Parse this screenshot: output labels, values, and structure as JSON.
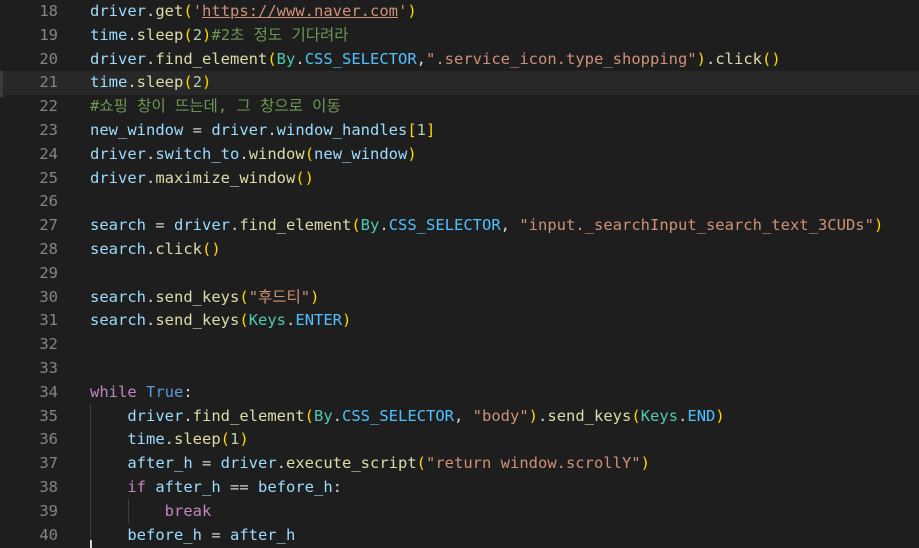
{
  "colors": {
    "background": "#1e1e1e",
    "line_number": "#858585",
    "variable": "#9cdcfe",
    "function": "#dcdcaa",
    "class": "#4ec9b0",
    "constant": "#4fc1ff",
    "string": "#ce9178",
    "number": "#b5cea8",
    "comment": "#6a9955",
    "keyword_control": "#c586c0",
    "keyword_builtin": "#569cd6",
    "bracket_level_1": "#ffd700",
    "bracket_level_2": "#da70d6",
    "bracket_level_3": "#179fff"
  },
  "editor": {
    "current_line": 21,
    "lines": [
      {
        "num": "18",
        "tokens": [
          [
            "var",
            "driver"
          ],
          [
            "op",
            "."
          ],
          [
            "fn",
            "get"
          ],
          [
            "b1",
            "("
          ],
          [
            "str",
            "'"
          ],
          [
            "str link",
            "https://www.naver.com"
          ],
          [
            "str",
            "'"
          ],
          [
            "b1",
            ")"
          ]
        ]
      },
      {
        "num": "19",
        "tokens": [
          [
            "var",
            "time"
          ],
          [
            "op",
            "."
          ],
          [
            "fn",
            "sleep"
          ],
          [
            "b1",
            "("
          ],
          [
            "num",
            "2"
          ],
          [
            "b1",
            ")"
          ],
          [
            "cmt",
            "#2초 정도 기다려라"
          ]
        ]
      },
      {
        "num": "20",
        "tokens": [
          [
            "var",
            "driver"
          ],
          [
            "op",
            "."
          ],
          [
            "fn",
            "find_element"
          ],
          [
            "b1",
            "("
          ],
          [
            "cls",
            "By"
          ],
          [
            "op",
            "."
          ],
          [
            "con",
            "CSS_SELECTOR"
          ],
          [
            "op",
            ","
          ],
          [
            "str",
            "\".service_icon.type_shopping\""
          ],
          [
            "b1",
            ")"
          ],
          [
            "op",
            "."
          ],
          [
            "fn",
            "click"
          ],
          [
            "b1",
            "()"
          ]
        ]
      },
      {
        "num": "21",
        "tokens": [
          [
            "var",
            "time"
          ],
          [
            "op",
            "."
          ],
          [
            "fn",
            "sleep"
          ],
          [
            "b1",
            "("
          ],
          [
            "num",
            "2"
          ],
          [
            "b1",
            ")"
          ]
        ]
      },
      {
        "num": "22",
        "tokens": [
          [
            "cmt",
            "#쇼핑 창이 뜨는데, 그 창으로 이동"
          ]
        ]
      },
      {
        "num": "23",
        "tokens": [
          [
            "var",
            "new_window"
          ],
          [
            "op",
            " = "
          ],
          [
            "var",
            "driver"
          ],
          [
            "op",
            "."
          ],
          [
            "var",
            "window_handles"
          ],
          [
            "b1",
            "["
          ],
          [
            "num",
            "1"
          ],
          [
            "b1",
            "]"
          ]
        ]
      },
      {
        "num": "24",
        "tokens": [
          [
            "var",
            "driver"
          ],
          [
            "op",
            "."
          ],
          [
            "var",
            "switch_to"
          ],
          [
            "op",
            "."
          ],
          [
            "fn",
            "window"
          ],
          [
            "b1",
            "("
          ],
          [
            "var",
            "new_window"
          ],
          [
            "b1",
            ")"
          ]
        ]
      },
      {
        "num": "25",
        "tokens": [
          [
            "var",
            "driver"
          ],
          [
            "op",
            "."
          ],
          [
            "fn",
            "maximize_window"
          ],
          [
            "b1",
            "()"
          ]
        ]
      },
      {
        "num": "26",
        "tokens": []
      },
      {
        "num": "27",
        "tokens": [
          [
            "var",
            "search"
          ],
          [
            "op",
            " = "
          ],
          [
            "var",
            "driver"
          ],
          [
            "op",
            "."
          ],
          [
            "fn",
            "find_element"
          ],
          [
            "b1",
            "("
          ],
          [
            "cls",
            "By"
          ],
          [
            "op",
            "."
          ],
          [
            "con",
            "CSS_SELECTOR"
          ],
          [
            "op",
            ", "
          ],
          [
            "str",
            "\"input._searchInput_search_text_3CUDs\""
          ],
          [
            "b1",
            ")"
          ]
        ]
      },
      {
        "num": "28",
        "tokens": [
          [
            "var",
            "search"
          ],
          [
            "op",
            "."
          ],
          [
            "fn",
            "click"
          ],
          [
            "b1",
            "()"
          ]
        ]
      },
      {
        "num": "29",
        "tokens": []
      },
      {
        "num": "30",
        "tokens": [
          [
            "var",
            "search"
          ],
          [
            "op",
            "."
          ],
          [
            "fn",
            "send_keys"
          ],
          [
            "b1",
            "("
          ],
          [
            "str",
            "\"후드티\""
          ],
          [
            "b1",
            ")"
          ]
        ]
      },
      {
        "num": "31",
        "tokens": [
          [
            "var",
            "search"
          ],
          [
            "op",
            "."
          ],
          [
            "fn",
            "send_keys"
          ],
          [
            "b1",
            "("
          ],
          [
            "cls",
            "Keys"
          ],
          [
            "op",
            "."
          ],
          [
            "con",
            "ENTER"
          ],
          [
            "b1",
            ")"
          ]
        ]
      },
      {
        "num": "32",
        "tokens": []
      },
      {
        "num": "33",
        "tokens": []
      },
      {
        "num": "34",
        "tokens": [
          [
            "kw",
            "while"
          ],
          [
            "op",
            " "
          ],
          [
            "kwb",
            "True"
          ],
          [
            "op",
            ":"
          ]
        ]
      },
      {
        "num": "35",
        "tokens": [
          [
            "op",
            "    "
          ],
          [
            "var",
            "driver"
          ],
          [
            "op",
            "."
          ],
          [
            "fn",
            "find_element"
          ],
          [
            "b1",
            "("
          ],
          [
            "cls",
            "By"
          ],
          [
            "op",
            "."
          ],
          [
            "con",
            "CSS_SELECTOR"
          ],
          [
            "op",
            ", "
          ],
          [
            "str",
            "\"body\""
          ],
          [
            "b1",
            ")"
          ],
          [
            "op",
            "."
          ],
          [
            "fn",
            "send_keys"
          ],
          [
            "b1",
            "("
          ],
          [
            "cls",
            "Keys"
          ],
          [
            "op",
            "."
          ],
          [
            "con",
            "END"
          ],
          [
            "b1",
            ")"
          ]
        ]
      },
      {
        "num": "36",
        "tokens": [
          [
            "op",
            "    "
          ],
          [
            "var",
            "time"
          ],
          [
            "op",
            "."
          ],
          [
            "fn",
            "sleep"
          ],
          [
            "b1",
            "("
          ],
          [
            "num",
            "1"
          ],
          [
            "b1",
            ")"
          ]
        ]
      },
      {
        "num": "37",
        "tokens": [
          [
            "op",
            "    "
          ],
          [
            "var",
            "after_h"
          ],
          [
            "op",
            " = "
          ],
          [
            "var",
            "driver"
          ],
          [
            "op",
            "."
          ],
          [
            "fn",
            "execute_script"
          ],
          [
            "b1",
            "("
          ],
          [
            "str",
            "\"return window.scrollY\""
          ],
          [
            "b1",
            ")"
          ]
        ]
      },
      {
        "num": "38",
        "tokens": [
          [
            "op",
            "    "
          ],
          [
            "kw",
            "if"
          ],
          [
            "op",
            " "
          ],
          [
            "var",
            "after_h"
          ],
          [
            "op",
            " == "
          ],
          [
            "var",
            "before_h"
          ],
          [
            "op",
            ":"
          ]
        ]
      },
      {
        "num": "39",
        "tokens": [
          [
            "op",
            "        "
          ],
          [
            "kw",
            "break"
          ]
        ]
      },
      {
        "num": "40",
        "tokens": [
          [
            "op",
            "    "
          ],
          [
            "var",
            "before_h"
          ],
          [
            "op",
            " = "
          ],
          [
            "var",
            "after_h"
          ]
        ]
      }
    ]
  }
}
